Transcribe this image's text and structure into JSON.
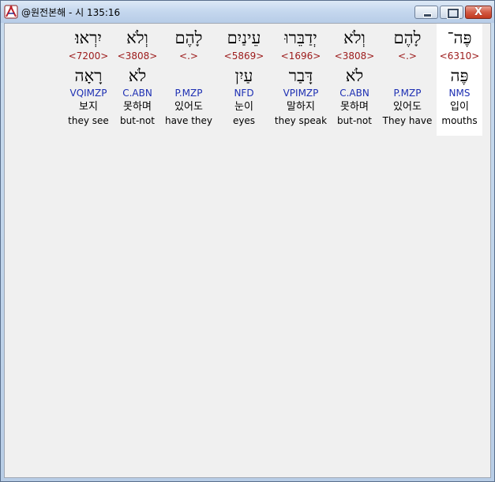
{
  "window": {
    "title": "@원전본해 - 시 135:16",
    "close_glyph": "X",
    "app_icon": "bible-compass-icon"
  },
  "colors": {
    "strong": "#9c1a1a",
    "morph": "#1d2fb3",
    "highlight": "#ffffff",
    "background": "#f0f0f0"
  },
  "words": [
    {
      "hebrew": "פֶּה־",
      "strong": "<6310>",
      "lemma": "פֶּה",
      "morph": "NMS",
      "korean": "입이",
      "english": "mouths"
    },
    {
      "hebrew": "לָהֶם",
      "strong": "<.>",
      "lemma": "",
      "morph": "P.MZP",
      "korean": "있어도",
      "english": "They have"
    },
    {
      "hebrew": "וְלֹא",
      "strong": "<3808>",
      "lemma": "לֹא",
      "morph": "C.ABN",
      "korean": "못하며",
      "english": "but-not"
    },
    {
      "hebrew": "יְדַבֵּרוּ",
      "strong": "<1696>",
      "lemma": "דָּבַר",
      "morph": "VPIMZP",
      "korean": "말하지",
      "english": "they speak"
    },
    {
      "hebrew": "עֵינַיִם",
      "strong": "<5869>",
      "lemma": "עַיִן",
      "morph": "NFD",
      "korean": "눈이",
      "english": "eyes"
    },
    {
      "hebrew": "לָהֶם",
      "strong": "<.>",
      "lemma": "",
      "morph": "P.MZP",
      "korean": "있어도",
      "english": "have they"
    },
    {
      "hebrew": "וְלֹא",
      "strong": "<3808>",
      "lemma": "לֹא",
      "morph": "C.ABN",
      "korean": "못하며",
      "english": "but-not"
    },
    {
      "hebrew": "יִרְאוּ׃",
      "strong": "<7200>",
      "lemma": "רָאָה",
      "morph": "VQIMZP",
      "korean": "보지",
      "english": "they see"
    }
  ]
}
